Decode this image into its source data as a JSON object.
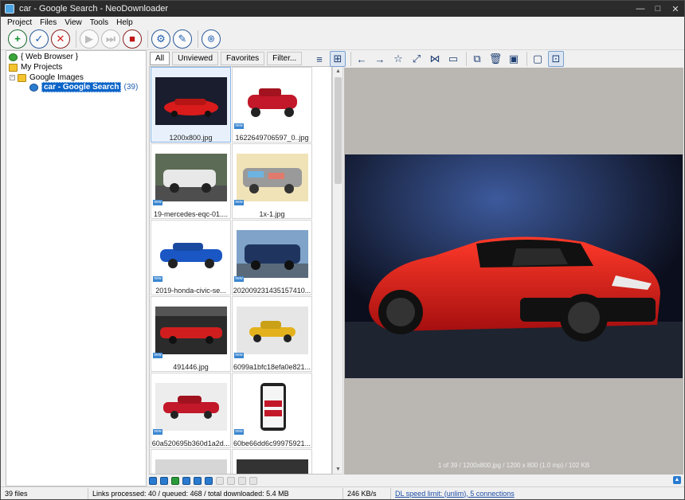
{
  "window": {
    "title": "car - Google Search - NeoDownloader"
  },
  "window_buttons": {
    "minimize": "—",
    "maximize": "□",
    "close": "✕"
  },
  "menu": {
    "items": [
      "Project",
      "Files",
      "View",
      "Tools",
      "Help"
    ]
  },
  "toolbar": {
    "icons": [
      "add-icon",
      "check-icon",
      "cancel-icon",
      "play-icon",
      "play-next-icon",
      "stop-icon",
      "settings-icon",
      "brush-icon",
      "map-pin-icon"
    ],
    "glyphs": {
      "add": "+",
      "check": "✓",
      "cancel": "✕",
      "play": "▶",
      "play_next": "⏭",
      "stop": "■",
      "settings": "⚙",
      "brush": "✎",
      "pin": "⌾"
    }
  },
  "tree": {
    "web_browser": "{ Web Browser }",
    "my_projects": "My Projects",
    "google_images": "Google Images",
    "project": "car - Google Search",
    "project_count": "(39)",
    "expander": "−"
  },
  "filter_tabs": [
    "All",
    "Unviewed",
    "Favorites",
    "Filter..."
  ],
  "thumbnails": [
    {
      "name": "1200x800.jpg",
      "new": false,
      "colors": {
        "bg": "#1a1d2e",
        "car": "#d91b1b"
      }
    },
    {
      "name": "1622649706597_0..jpg",
      "new": true,
      "colors": {
        "bg": "#ffffff",
        "car": "#c3182a"
      }
    },
    {
      "name": "19-mercedes-eqc-01....",
      "new": true,
      "colors": {
        "bg": "#5c6b55",
        "car": "#e8e8e8"
      }
    },
    {
      "name": "1x-1.jpg",
      "new": true,
      "colors": {
        "bg": "#f0e3b8",
        "car": "#9a9a9a"
      }
    },
    {
      "name": "2019-honda-civic-se...",
      "new": true,
      "colors": {
        "bg": "#ffffff",
        "car": "#1a57c4"
      }
    },
    {
      "name": "20200923143515741​0...",
      "new": true,
      "colors": {
        "bg": "#7fa3c9",
        "car": "#1f3560"
      }
    },
    {
      "name": "491446.jpg",
      "new": true,
      "colors": {
        "bg": "#2b2b2b",
        "car": "#d01e1e"
      }
    },
    {
      "name": "6099a1bfc18efa0e821...",
      "new": true,
      "colors": {
        "bg": "#e6e6e6",
        "car": "#e3b11c"
      }
    },
    {
      "name": "60a520695b360d1a2d...",
      "new": true,
      "colors": {
        "bg": "#ededed",
        "car": "#c2182a"
      }
    },
    {
      "name": "60be66dd6c99975921...",
      "new": true,
      "colors": {
        "bg": "#ffffff",
        "car": "#222222"
      }
    }
  ],
  "new_badge": "new",
  "viewer_toolbar": {
    "glyphs": {
      "list": "≡",
      "grid": "⊞",
      "back": "←",
      "forward": "→",
      "favorite": "☆",
      "link": "⤢",
      "share": "⋈",
      "slideshow": "▭",
      "crop": "⧉",
      "delete": "🗑",
      "wallpaper": "▣",
      "fullscreen": "▢",
      "actual": "⊡"
    }
  },
  "viewer": {
    "info": "1 of 39 / 1200x800.jpg / 1200 x 800 (1.0 mp) / 102 KB"
  },
  "playbar": {
    "up": "▲"
  },
  "status": {
    "files": "39 files",
    "links": "Links processed: 40 / queued: 468 / total downloaded: 5.4 MB",
    "speed": "246 KB/s",
    "limit": "DL speed limit: (unlim), 5 connections"
  },
  "scroll": {
    "up": "▲",
    "down": "▼"
  }
}
